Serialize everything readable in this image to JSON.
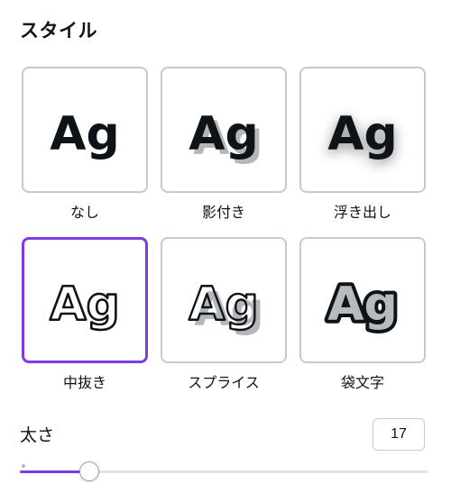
{
  "panel": {
    "title": "スタイル"
  },
  "styles": [
    {
      "id": "none",
      "label": "なし",
      "preview": "Ag",
      "selected": false
    },
    {
      "id": "shadow",
      "label": "影付き",
      "preview": "Ag",
      "selected": false
    },
    {
      "id": "lift",
      "label": "浮き出し",
      "preview": "Ag",
      "selected": false
    },
    {
      "id": "hollow",
      "label": "中抜き",
      "preview": "Ag",
      "selected": true
    },
    {
      "id": "splice",
      "label": "スプライス",
      "preview": "Ag",
      "selected": false
    },
    {
      "id": "outline",
      "label": "袋文字",
      "preview": "Ag",
      "selected": false
    }
  ],
  "thickness": {
    "label": "太さ",
    "value": "17",
    "min": 0,
    "max": 100,
    "fraction": 0.17
  },
  "colors": {
    "accent": "#7d3ce0",
    "text": "#0e1318",
    "tile_border": "#c7c9cc",
    "shadow_gray": "#b4b6b9",
    "outline_fill": "#b8bbbe"
  }
}
